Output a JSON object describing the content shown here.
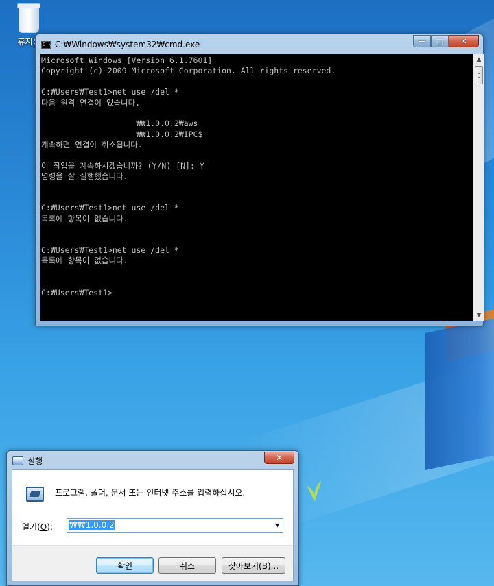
{
  "desktop": {
    "recycle_bin_label": "휴지통"
  },
  "cmd_window": {
    "title": "C:₩Windows₩system32₩cmd.exe",
    "icon_text": "C:\\",
    "controls": {
      "minimize": "—",
      "maximize": "□",
      "close": "✕"
    },
    "lines": [
      "Microsoft Windows [Version 6.1.7601]",
      "Copyright (c) 2009 Microsoft Corporation. All rights reserved.",
      "",
      "C:₩Users₩Test1>net use /del *",
      "다음 원격 연결이 있습니다.",
      "",
      "                    ₩₩1.0.0.2₩aws",
      "                    ₩₩1.0.0.2₩IPC$",
      "계속하면 연결이 취소됩니다.",
      "",
      "이 작업을 계속하시겠습니까? (Y/N) [N]: Y",
      "명령을 잘 실행했습니다.",
      "",
      "",
      "C:₩Users₩Test1>net use /del *",
      "목록에 항목이 없습니다.",
      "",
      "",
      "C:₩Users₩Test1>net use /del *",
      "목록에 항목이 없습니다.",
      "",
      "",
      "C:₩Users₩Test1>"
    ],
    "scroll": {
      "up": "▲",
      "down": "▼"
    }
  },
  "run_dialog": {
    "title": "실행",
    "close": "✕",
    "description": "프로그램, 폴더, 문서 또는 인터넷 주소를 입력하십시오.",
    "open_label": "열기(",
    "open_label_hotkey": "O",
    "open_label_end": "):",
    "input_value": "₩₩1.0.0.2",
    "dropdown_glyph": "▼",
    "buttons": {
      "ok": "확인",
      "cancel": "취소",
      "browse": "찾아보기(B)..."
    }
  }
}
